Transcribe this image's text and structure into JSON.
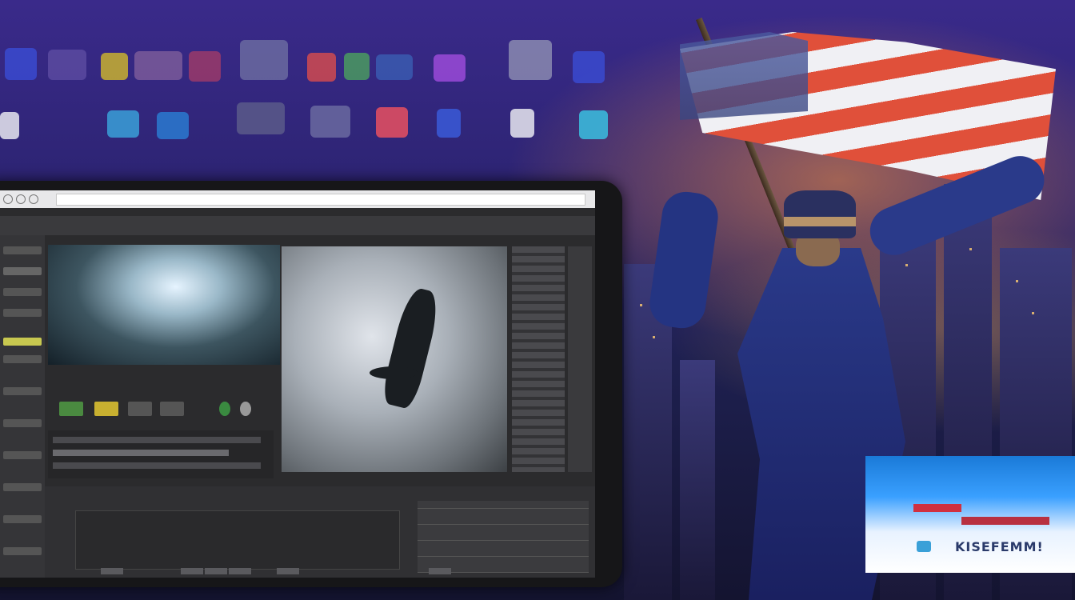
{
  "scene": {
    "sign": {
      "text": "KISEFEMM!"
    }
  },
  "editor": {
    "window_title": "",
    "panel_label": "",
    "address": ""
  },
  "palette": {
    "background": "#2b2370",
    "flag_red": "#e0503a",
    "flag_white": "#f0f0f4",
    "jacket_blue": "#2a3a8a",
    "sign_blue": "#3aa0ff",
    "ui_dark": "#2b2b2d"
  },
  "icons": [
    "app-tile-icon",
    "flag-icon",
    "play-icon",
    "record-icon"
  ]
}
